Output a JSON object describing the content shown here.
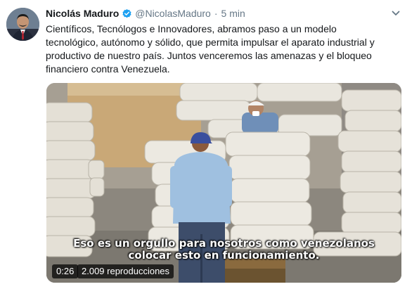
{
  "tweet": {
    "author_name": "Nicolás Maduro",
    "handle": "@NicolasMaduro",
    "separator": "·",
    "time": "5 min",
    "text": "Científicos, Tecnólogos e Innovadores, abramos paso a un modelo tecnológico, autónomo y sólido, que permita impulsar el aparato industrial y productivo de nuestro país. Juntos venceremos las amenazas y el bloqueo financiero contra Venezuela.",
    "verified_icon": "verified-badge-icon",
    "menu_icon": "chevron-down-icon"
  },
  "video": {
    "subtitle_line1": "Eso es un orgullo para nosotros como venezolanos",
    "subtitle_line2": "colocar esto en funcionamiento.",
    "duration": "0:26",
    "views": "2.009 reproducciones"
  },
  "colors": {
    "accent": "#1da1f2",
    "muted": "#657786",
    "text": "#14171a"
  }
}
